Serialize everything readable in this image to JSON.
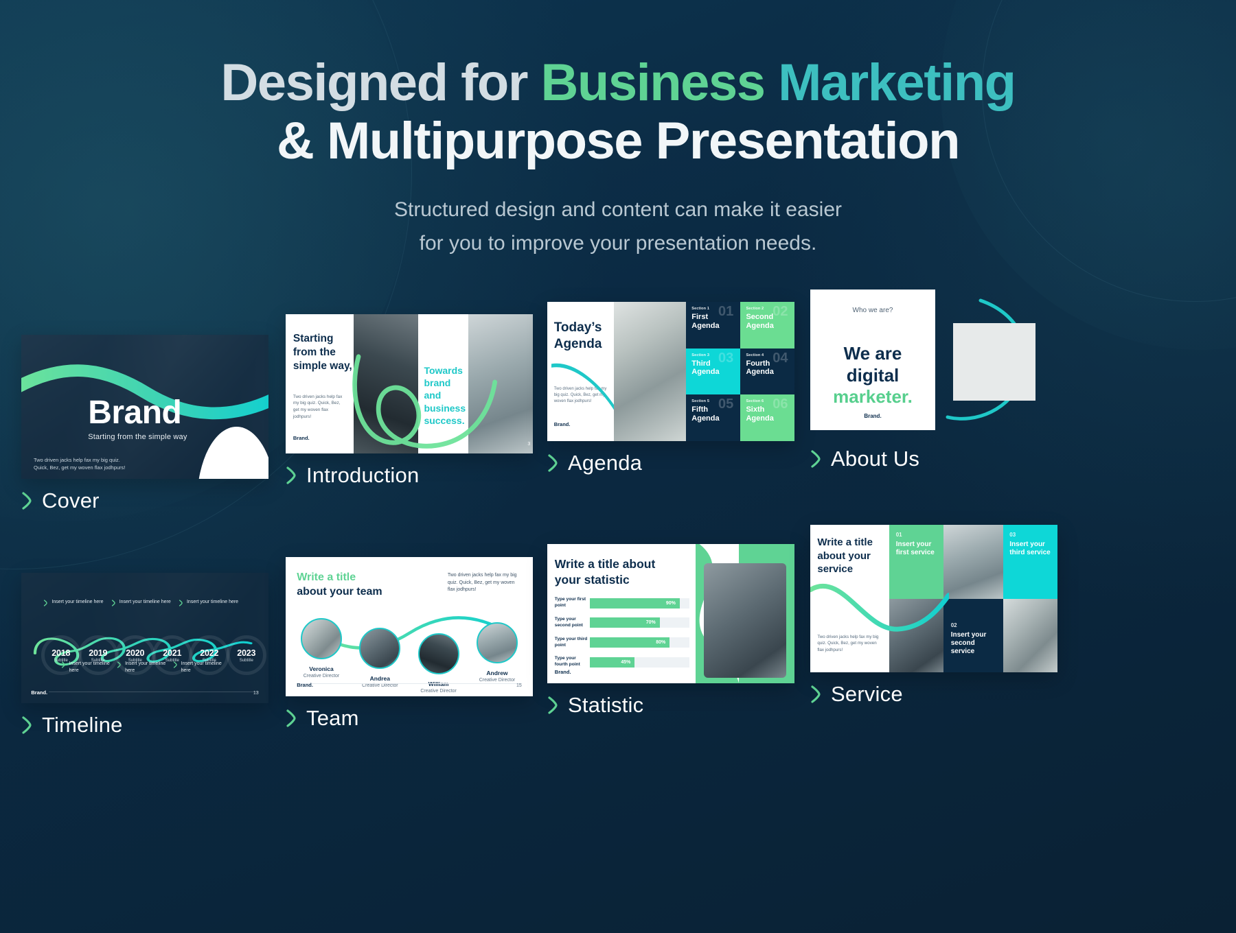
{
  "header": {
    "title_part1": "Designed for ",
    "title_part2": "Business ",
    "title_part3": "Marketing",
    "title_line2": "& Multipurpose Presentation",
    "subtitle_line1": "Structured design and content can make it easier",
    "subtitle_line2": "for you to improve your presentation needs."
  },
  "colors": {
    "background": "#0b2840",
    "green": "#5fd394",
    "teal": "#1fc8c8",
    "cyan": "#0ed7d7",
    "navy": "#0b2a44",
    "white": "#ffffff"
  },
  "slides": {
    "cover": {
      "caption": "Cover",
      "title": "Brand",
      "subtitle": "Starting from the simple way",
      "note": "Two driven jacks help fax my big quiz. Quick, Bez, get my woven flax jodhpurs!"
    },
    "introduction": {
      "caption": "Introduction",
      "heading": "Starting from the simple way,",
      "heading2": "Towards brand and business success.",
      "body": "Two driven jacks help fax my big quiz. Quick, Bez, get my woven flax jodhpurs!",
      "brand": "Brand.",
      "page": "3"
    },
    "agenda": {
      "caption": "Agenda",
      "title": "Today’s Agenda",
      "note": "Two driven jacks help fax my big quiz. Quick, Bez, get my woven flax jodhpurs!",
      "brand": "Brand.",
      "items": [
        {
          "section": "Section 1",
          "number": "01",
          "label": "First Agenda",
          "style": "dark"
        },
        {
          "section": "Section 2",
          "number": "02",
          "label": "Second Agenda",
          "style": "green"
        },
        {
          "section": "Section 3",
          "number": "03",
          "label": "Third Agenda",
          "style": "cyan"
        },
        {
          "section": "Section 4",
          "number": "04",
          "label": "Fourth Agenda",
          "style": "dark"
        },
        {
          "section": "Section 5",
          "number": "05",
          "label": "Fifth Agenda",
          "style": "dark"
        },
        {
          "section": "Section 6",
          "number": "06",
          "label": "Sixth Agenda",
          "style": "green"
        }
      ]
    },
    "about": {
      "caption": "About Us",
      "kicker": "Who we are?",
      "heading_line1": "We are",
      "heading_line2": "digital",
      "heading_accent": "marketer.",
      "brand": "Brand."
    },
    "timeline": {
      "caption": "Timeline",
      "top_labels": [
        "Insert your timeline here",
        "Insert your timeline here",
        "Insert your timeline here"
      ],
      "bottom_labels": [
        "Insert your timeline here",
        "Insert your timeline here",
        "Insert your timeline here"
      ],
      "years": [
        {
          "year": "2018",
          "subtitle": "Subtitle"
        },
        {
          "year": "2019",
          "subtitle": "Subtitle"
        },
        {
          "year": "2020",
          "subtitle": "Subtitle"
        },
        {
          "year": "2021",
          "subtitle": "Subtitle"
        },
        {
          "year": "2022",
          "subtitle": "Subtitle"
        },
        {
          "year": "2023",
          "subtitle": "Subtitle"
        }
      ],
      "brand": "Brand.",
      "page": "13"
    },
    "team": {
      "caption": "Team",
      "heading_line1": "Write a title",
      "heading_line2": "about your team",
      "note": "Two driven jacks help fax my big quiz. Quick, Bez, get my woven flax jodhpurs!",
      "members": [
        {
          "name": "Veronica",
          "role": "Creative Director"
        },
        {
          "name": "Andrea",
          "role": "Creative Director"
        },
        {
          "name": "William",
          "role": "Creative Director"
        },
        {
          "name": "Andrew",
          "role": "Creative Director"
        }
      ],
      "brand": "Brand.",
      "page": "15"
    },
    "statistic": {
      "caption": "Statistic",
      "heading_line1": "Write a title about",
      "heading_line2": "your statistic",
      "brand": "Brand.",
      "bars": [
        {
          "label": "Type your first point",
          "value": "90%",
          "percent": 90
        },
        {
          "label": "Type your second point",
          "value": "70%",
          "percent": 70
        },
        {
          "label": "Type your third point",
          "value": "80%",
          "percent": 80
        },
        {
          "label": "Type your fourth point",
          "value": "45%",
          "percent": 45
        }
      ]
    },
    "service": {
      "caption": "Service",
      "heading_line1": "Write a title",
      "heading_line2": "about your",
      "heading_line3": "service",
      "note": "Two driven jacks help fax my big quiz. Quick, Bez, get my woven flax jodhpurs!",
      "items": [
        {
          "number": "01",
          "label": "Insert your first service",
          "style": "green"
        },
        {
          "number": "03",
          "label": "Insert your third service",
          "style": "cyan"
        },
        {
          "number": "02",
          "label": "Insert your second service",
          "style": "dark"
        }
      ]
    }
  },
  "chart_data": {
    "type": "bar",
    "title": "Write a title about your statistic",
    "categories": [
      "Type your first point",
      "Type your second point",
      "Type your third point",
      "Type your fourth point"
    ],
    "values": [
      90,
      70,
      80,
      45
    ],
    "xlabel": "",
    "ylabel": "",
    "xlim": [
      0,
      100
    ],
    "grid": false,
    "legend": "none",
    "orientation": "horizontal"
  }
}
